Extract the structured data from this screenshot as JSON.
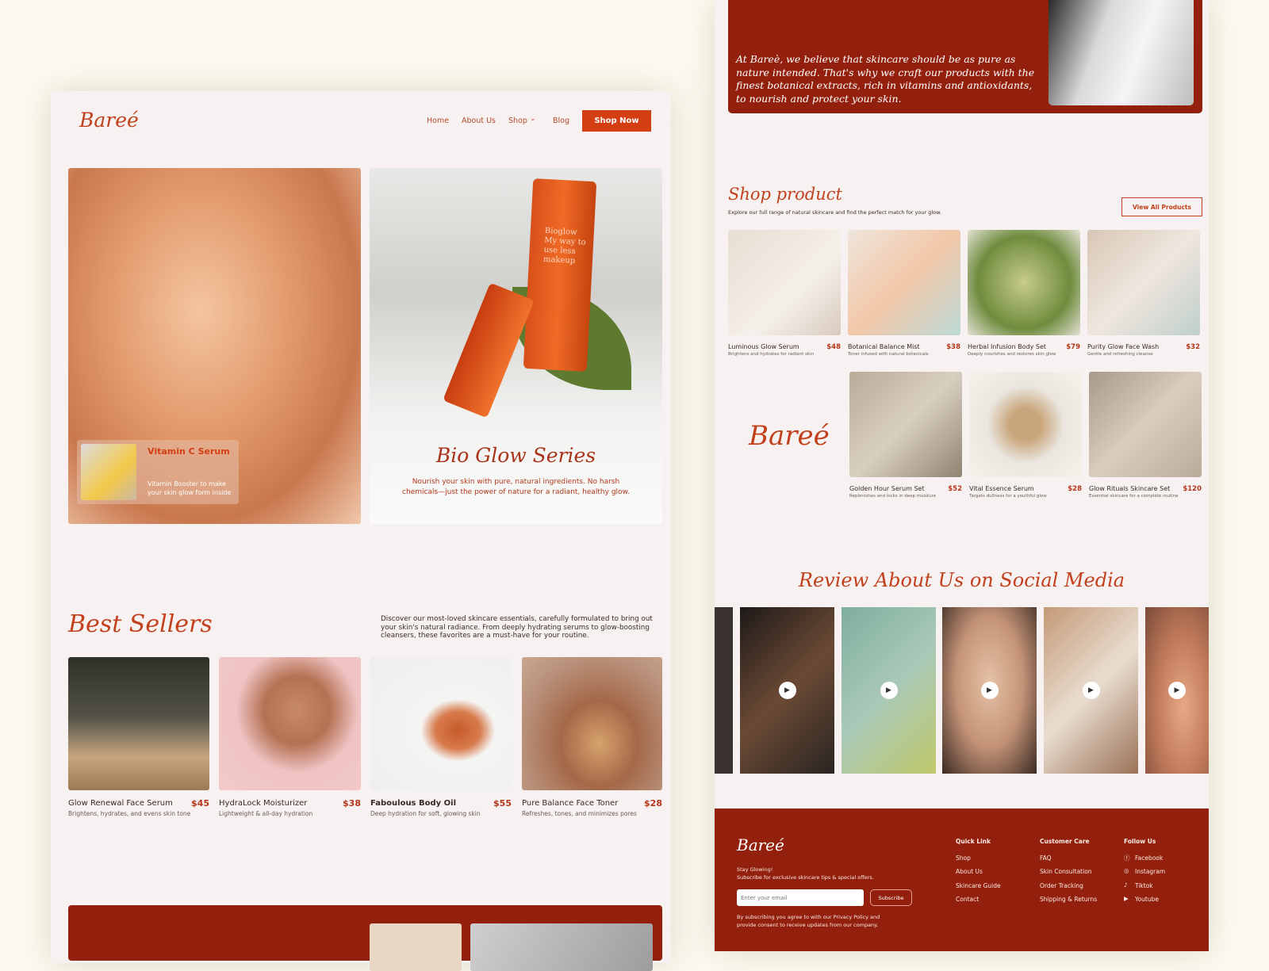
{
  "brand": "Bareé",
  "nav": {
    "items": [
      "Home",
      "About Us",
      "Shop",
      "Blog"
    ],
    "shop_chevron": "chevron-down-icon",
    "cta": "Shop Now"
  },
  "hero": {
    "card_title": "Vitamin C Serum",
    "card_text": "Vitamin Booster to make your skin glow form inside",
    "series_title": "Bio Glow Series",
    "series_text": "Nourish your skin with pure, natural ingredients. No harsh chemicals—just the power of nature for a radiant, healthy glow.",
    "tube_text": "Bioglow My way to use less makeup"
  },
  "best_sellers": {
    "title": "Best Sellers",
    "description": "Discover our most-loved skincare essentials, carefully formulated to bring out your skin's natural radiance. From deeply hydrating serums to glow-boosting cleansers, these favorites are a must-have for your routine.",
    "products": [
      {
        "name": "Glow Renewal Face Serum",
        "price": "$45",
        "desc": "Brightens, hydrates, and evens skin tone"
      },
      {
        "name": "HydraLock Moisturizer",
        "price": "$38",
        "desc": "Lightweight & all-day hydration"
      },
      {
        "name": "Faboulous Body Oil",
        "price": "$55",
        "desc": "Deep hydration for soft, glowing skin"
      },
      {
        "name": "Pure Balance Face Toner",
        "price": "$28",
        "desc": "Refreshes, tones, and minimizes pores"
      }
    ]
  },
  "about": {
    "text": "At Bareè, we believe that skincare should be as pure as nature intended. That's why we craft our products with the finest botanical extracts, rich in vitamins and antioxidants, to nourish and protect your skin."
  },
  "shop": {
    "title": "Shop product",
    "subtitle": "Explore our full range of natural skincare and find the perfect match for your glow.",
    "view_all": "View All Products",
    "products": [
      {
        "name": "Luminous Glow Serum",
        "price": "$48",
        "desc": "Brightens and hydrates for radiant skin"
      },
      {
        "name": "Botanical Balance Mist",
        "price": "$38",
        "desc": "Toner infused with natural botanicals"
      },
      {
        "name": "Herbal Infusion Body Set",
        "price": "$79",
        "desc": "Deeply nourishes and restores skin glow"
      },
      {
        "name": "Purity Glow Face Wash",
        "price": "$32",
        "desc": "Gentle and refreshing cleanse"
      },
      {
        "name": "Golden Hour Serum Set",
        "price": "$52",
        "desc": "Replenishes and locks in deep moisture"
      },
      {
        "name": "Vital Essence Serum",
        "price": "$28",
        "desc": "Targets dullness for a youthful glow"
      },
      {
        "name": "Glow Rituals Skincare Set",
        "price": "$120",
        "desc": "Essential skincare for a complete routine"
      }
    ]
  },
  "reviews": {
    "title": "Review About Us on Social Media",
    "play_icon": "play-icon"
  },
  "footer": {
    "tagline": "Stay Glowing!",
    "subtext": "Subscribe for exclusive skincare tips & special offers.",
    "email_placeholder": "Enter your email",
    "subscribe": "Subscribe",
    "legal": "By subscribing you agree to with our Privacy Policy and provide consent to receive updates from our company.",
    "quick_link": {
      "title": "Quick Link",
      "items": [
        "Shop",
        "About Us",
        "Skincare Guide",
        "Contact"
      ]
    },
    "customer_care": {
      "title": "Customer Care",
      "items": [
        "FAQ",
        "Skin Consultation",
        "Order Tracking",
        "Shipping & Returns"
      ]
    },
    "follow": {
      "title": "Follow Us",
      "items": [
        "Facebook",
        "Instagram",
        "Tiktok",
        "Youtube"
      ]
    }
  },
  "colors": {
    "accent": "#d33e12",
    "brand_red": "#93200d",
    "background": "#fdfbf0",
    "page": "#f7f2f1"
  }
}
